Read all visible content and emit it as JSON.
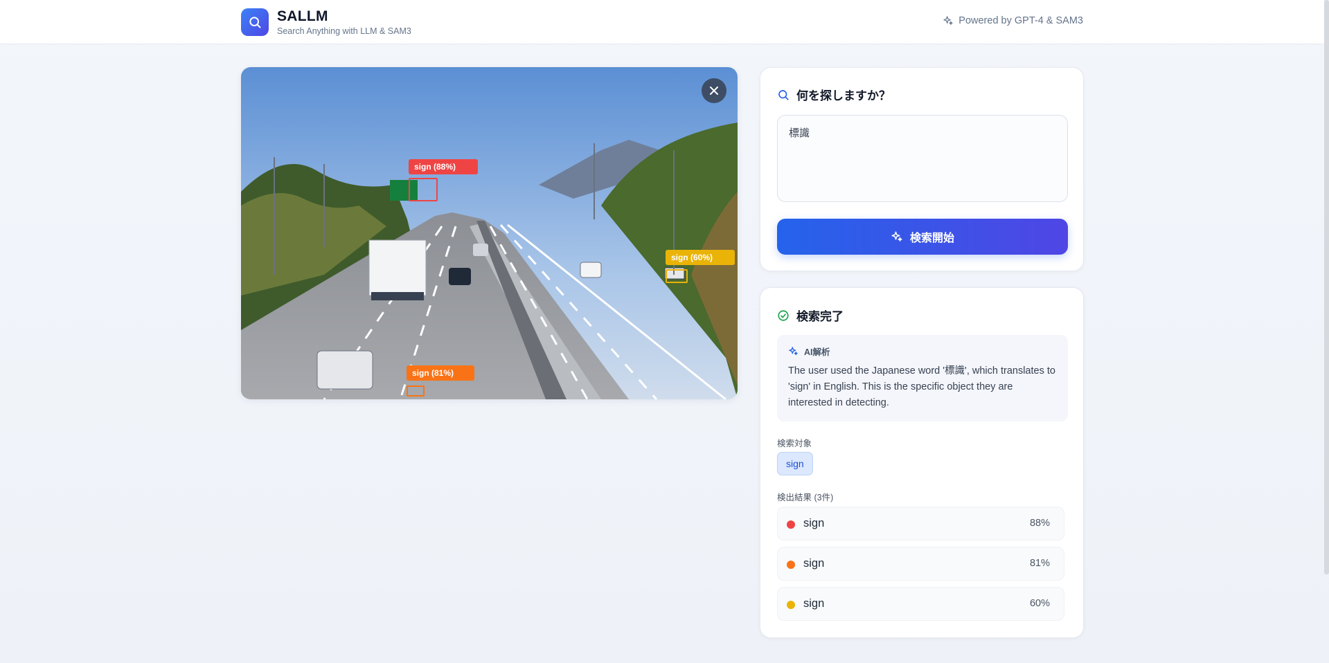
{
  "header": {
    "title": "SALLM",
    "subtitle": "Search Anything with LLM & SAM3",
    "powered_by": "Powered by GPT-4 & SAM3"
  },
  "image_panel": {
    "detections": [
      {
        "label": "sign (88%)",
        "color": "#ef4444"
      },
      {
        "label": "sign (81%)",
        "color": "#f97316"
      },
      {
        "label": "sign (60%)",
        "color": "#eab308"
      }
    ]
  },
  "search_card": {
    "title": "何を探しますか？",
    "query": "標識",
    "button_label": "検索開始"
  },
  "result_card": {
    "title": "検索完了",
    "ai_heading": "AI解析",
    "ai_text": "The user used the Japanese word '標識', which translates to 'sign' in English. This is the specific object they are interested in detecting.",
    "target_label": "検索対象",
    "target_chip": "sign",
    "results_label": "検出結果 (3件)",
    "results": [
      {
        "name": "sign",
        "confidence": "88%",
        "color": "#ef4444"
      },
      {
        "name": "sign",
        "confidence": "81%",
        "color": "#f97316"
      },
      {
        "name": "sign",
        "confidence": "60%",
        "color": "#eab308"
      }
    ]
  },
  "colors": {
    "accent": "#2563eb",
    "accent_end": "#4f46e5",
    "success": "#16a34a"
  }
}
